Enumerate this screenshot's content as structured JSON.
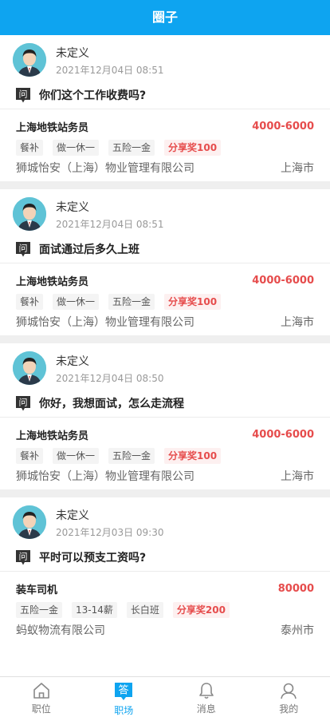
{
  "header": {
    "title": "圈子"
  },
  "posts": [
    {
      "user": "未定义",
      "time": "2021年12月04日 08:51",
      "question_icon_glyph": "问",
      "question": "你们这个工作收费吗?",
      "job": {
        "title": "上海地铁站务员",
        "salary": "4000-6000",
        "tags": [
          "餐补",
          "做一休一",
          "五险一金"
        ],
        "bonus": "分享奖100",
        "company": "狮城怡安（上海）物业管理有限公司",
        "city": "上海市"
      }
    },
    {
      "user": "未定义",
      "time": "2021年12月04日 08:51",
      "question_icon_glyph": "问",
      "question": "面试通过后多久上班",
      "job": {
        "title": "上海地铁站务员",
        "salary": "4000-6000",
        "tags": [
          "餐补",
          "做一休一",
          "五险一金"
        ],
        "bonus": "分享奖100",
        "company": "狮城怡安（上海）物业管理有限公司",
        "city": "上海市"
      }
    },
    {
      "user": "未定义",
      "time": "2021年12月04日 08:50",
      "question_icon_glyph": "问",
      "question": "你好，我想面试，怎么走流程",
      "job": {
        "title": "上海地铁站务员",
        "salary": "4000-6000",
        "tags": [
          "餐补",
          "做一休一",
          "五险一金"
        ],
        "bonus": "分享奖100",
        "company": "狮城怡安（上海）物业管理有限公司",
        "city": "上海市"
      }
    },
    {
      "user": "未定义",
      "time": "2021年12月03日 09:30",
      "question_icon_glyph": "问",
      "question": "平时可以预支工资吗?",
      "job": {
        "title": "装车司机",
        "salary": "80000",
        "tags": [
          "五险一金",
          "13-14薪",
          "长白班"
        ],
        "bonus": "分享奖200",
        "company": "蚂蚁物流有限公司",
        "city": "泰州市"
      }
    }
  ],
  "tabbar": [
    {
      "label": "职位",
      "icon": "home-icon"
    },
    {
      "label": "职场",
      "icon": "answer-icon",
      "glyph": "答",
      "active": true
    },
    {
      "label": "消息",
      "icon": "bell-icon"
    },
    {
      "label": "我的",
      "icon": "user-icon"
    }
  ],
  "colors": {
    "primary": "#0ea4f0",
    "salary": "#e64c4c",
    "avatar_bg": "#5fc3d6"
  }
}
